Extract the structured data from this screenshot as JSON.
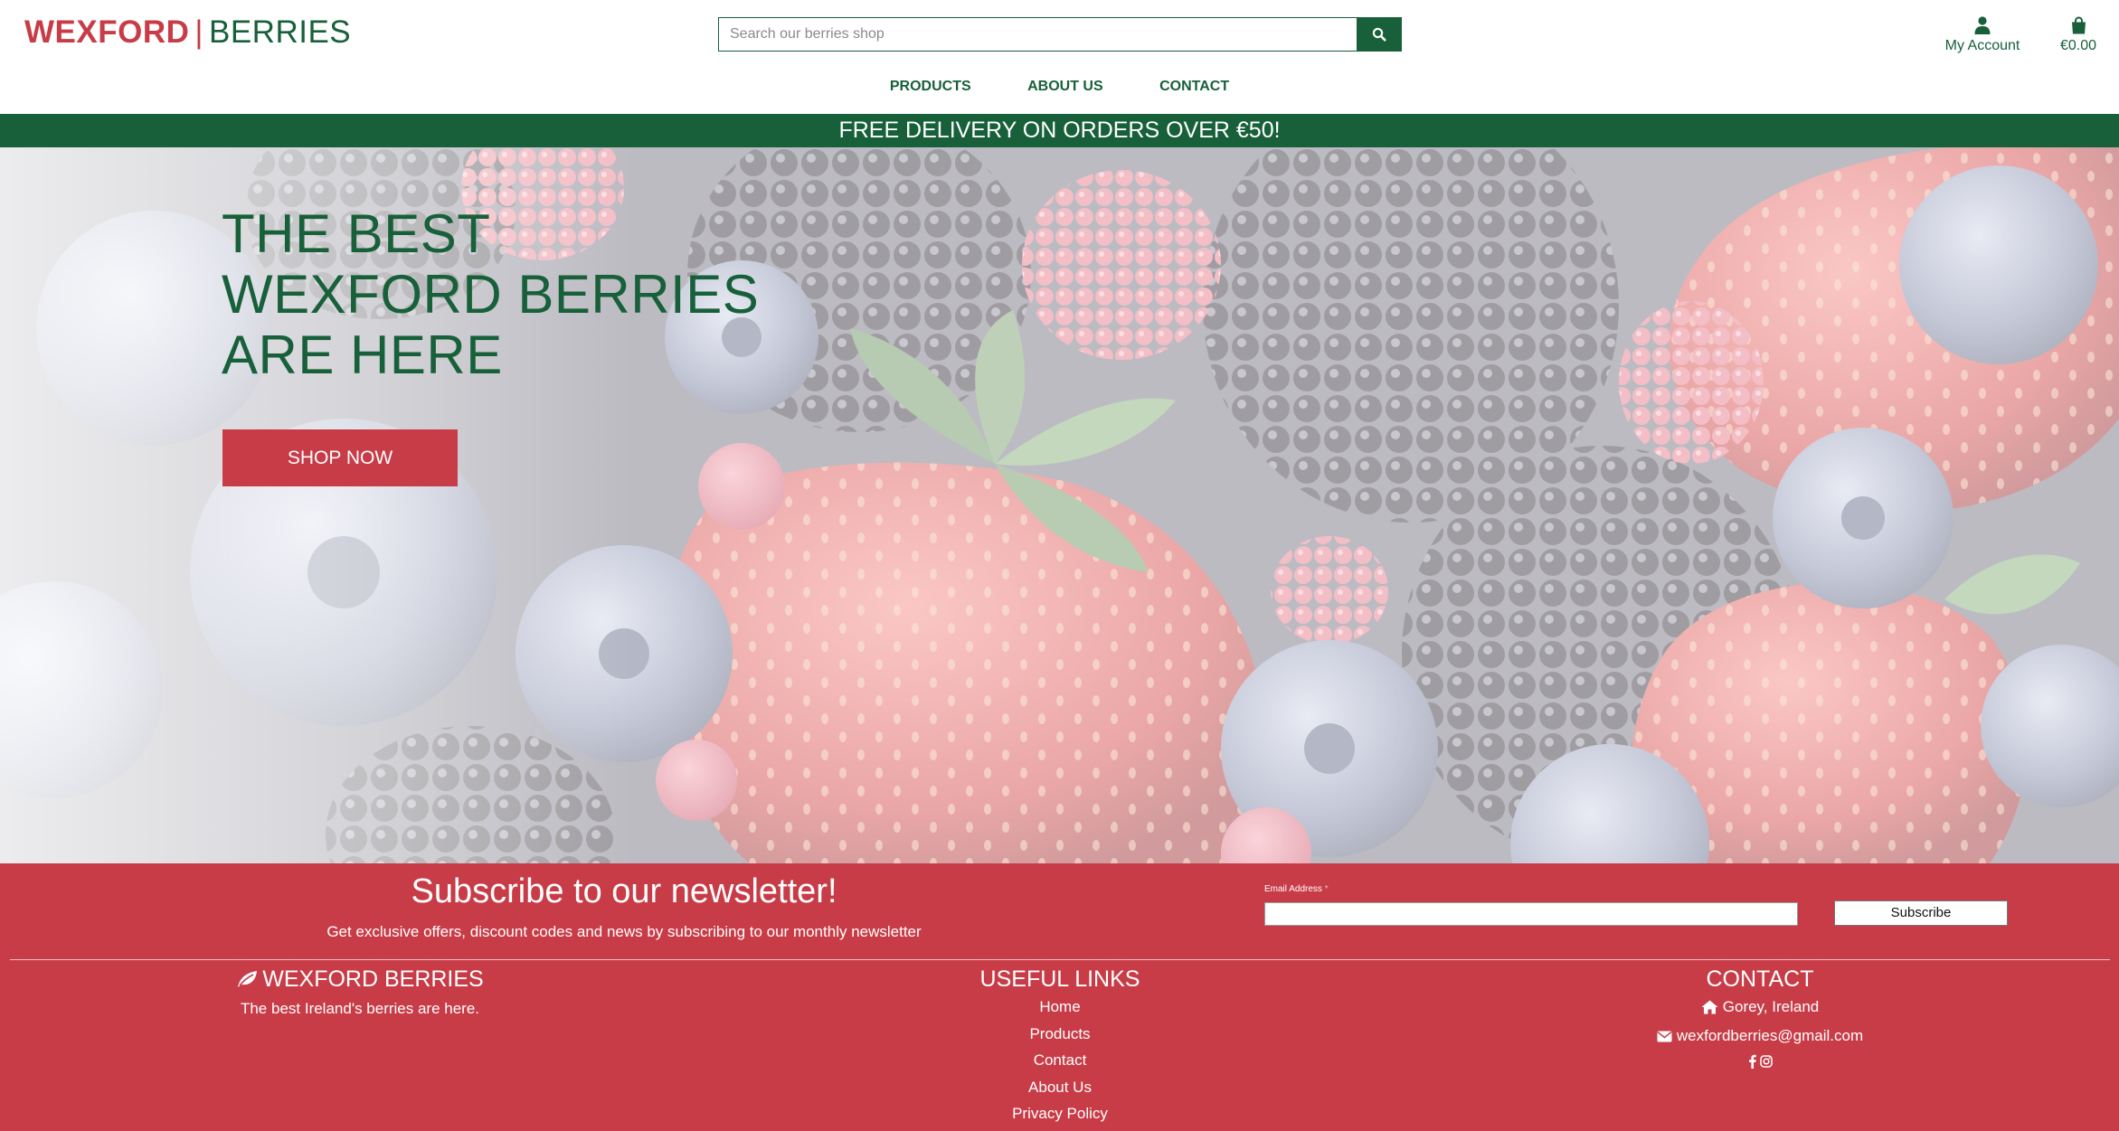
{
  "header": {
    "logo_primary": "WEXFORD",
    "logo_separator": "|",
    "logo_secondary": "BERRIES",
    "search_placeholder": "Search our berries shop",
    "account_label": "My Account",
    "cart_total": "€0.00"
  },
  "nav": {
    "items": [
      {
        "label": "PRODUCTS"
      },
      {
        "label": "ABOUT US"
      },
      {
        "label": "CONTACT"
      }
    ]
  },
  "banner": {
    "text": "FREE DELIVERY ON ORDERS OVER €50!"
  },
  "hero": {
    "title_lines": [
      "THE BEST",
      "WEXFORD BERRIES",
      "ARE HERE"
    ],
    "cta_label": "SHOP NOW"
  },
  "newsletter": {
    "title": "Subscribe to our newsletter!",
    "subtitle": "Get exclusive offers, discount codes and news by subscribing to our monthly newsletter",
    "email_label": "Email Address",
    "required_marker": "*",
    "email_value": "",
    "button_label": "Subscribe"
  },
  "footer": {
    "brand": {
      "title": "WEXFORD BERRIES",
      "tagline": "The best Ireland's berries are here."
    },
    "links": {
      "title": "USEFUL LINKS",
      "items": [
        {
          "label": "Home"
        },
        {
          "label": "Products"
        },
        {
          "label": "Contact"
        },
        {
          "label": "About Us"
        },
        {
          "label": "Privacy Policy"
        }
      ]
    },
    "contact": {
      "title": "CONTACT",
      "address": "Gorey, Ireland",
      "email": "wexfordberries@gmail.com"
    }
  },
  "colors": {
    "brand_green": "#17603a",
    "brand_red": "#c83c47",
    "white": "#ffffff"
  },
  "icons": [
    "search-icon",
    "user-icon",
    "shopping-bag-icon",
    "leaf-icon",
    "home-icon",
    "envelope-icon",
    "facebook-icon",
    "instagram-icon"
  ]
}
